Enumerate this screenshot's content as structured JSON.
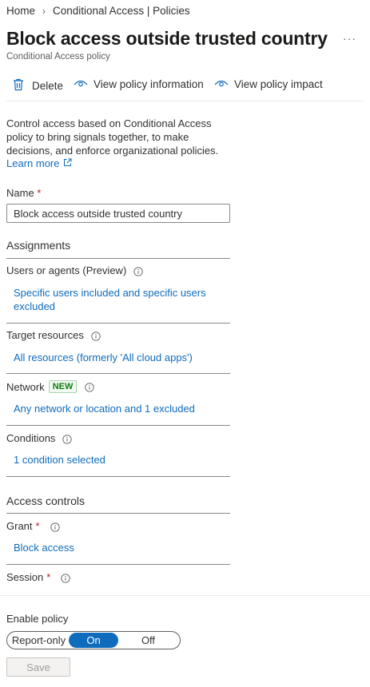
{
  "breadcrumb": {
    "home": "Home",
    "separator": "›",
    "current": "Conditional Access | Policies"
  },
  "page": {
    "title": "Block access outside trusted country",
    "subtitle": "Conditional Access policy",
    "more_label": "···"
  },
  "toolbar": {
    "delete_label": "Delete",
    "view_info_label": "View policy information",
    "view_impact_label": "View policy impact"
  },
  "intro": {
    "description": "Control access based on Conditional Access policy to bring signals together, to make decisions, and enforce organizational policies.",
    "learn_more": "Learn more"
  },
  "name_field": {
    "label": "Name",
    "required_mark": "*",
    "value": "Block access outside trusted country"
  },
  "assignments": {
    "heading": "Assignments",
    "users": {
      "label": "Users or agents (Preview)",
      "link": "Specific users included and specific users excluded"
    },
    "target": {
      "label": "Target resources",
      "link": "All resources (formerly 'All cloud apps')"
    },
    "network": {
      "label": "Network",
      "badge": "NEW",
      "link": "Any network or location and 1 excluded"
    },
    "conditions": {
      "label": "Conditions",
      "link": "1 condition selected"
    }
  },
  "access_controls": {
    "heading": "Access controls",
    "grant": {
      "label": "Grant",
      "required_mark": "*",
      "link": "Block access"
    },
    "session": {
      "label": "Session",
      "required_mark": "*"
    }
  },
  "enable_policy": {
    "label": "Enable policy",
    "options": [
      "Report-only",
      "On",
      "Off"
    ],
    "selected": "On"
  },
  "save_label": "Save",
  "colors": {
    "link": "#0f6cbd",
    "required": "#a4262c",
    "badge_text": "#107c10"
  }
}
